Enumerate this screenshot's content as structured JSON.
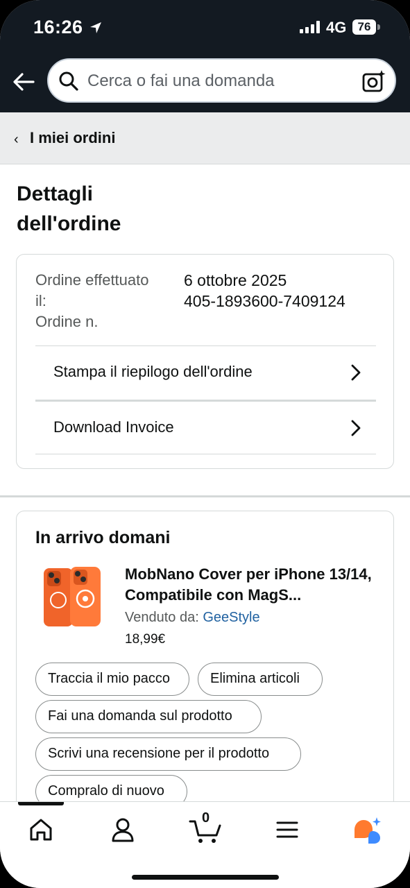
{
  "status_bar": {
    "time": "16:26",
    "network": "4G",
    "battery": "76"
  },
  "search": {
    "placeholder": "Cerca o fai una domanda"
  },
  "breadcrumb": {
    "label": "I miei ordini"
  },
  "page": {
    "title": "Dettagli dell'ordine"
  },
  "order": {
    "label_placed": "Ordine effettuato il:",
    "label_number": "Ordine n.",
    "date": "6 ottobre 2025",
    "number": "405-1893600-7409124",
    "links": [
      {
        "label": "Stampa il riepilogo dell'ordine"
      },
      {
        "label": "Download Invoice"
      }
    ]
  },
  "delivery": {
    "title": "In arrivo domani",
    "product": {
      "title": "MobNano Cover per iPhone 13/14, Compatibile con MagS...",
      "seller_label": "Venduto da: ",
      "seller_name": "GeeStyle",
      "price": "18,99€"
    },
    "actions": [
      {
        "label": "Traccia il mio pacco"
      },
      {
        "label": "Elimina articoli"
      },
      {
        "label": "Fai una domanda sul prodotto"
      },
      {
        "label": "Scrivi una recensione per il prodotto"
      },
      {
        "label": "Compralo di nuovo"
      }
    ]
  },
  "bottom_nav": {
    "items": [
      {
        "icon": "home-icon"
      },
      {
        "icon": "user-icon"
      },
      {
        "icon": "cart-icon",
        "count": "0"
      },
      {
        "icon": "menu-icon"
      },
      {
        "icon": "ai-assistant-icon"
      }
    ]
  },
  "colors": {
    "header_bg": "#131a22",
    "link": "#2162a1",
    "ai_orange": "#ff7a2e",
    "ai_blue": "#3e8bff"
  }
}
